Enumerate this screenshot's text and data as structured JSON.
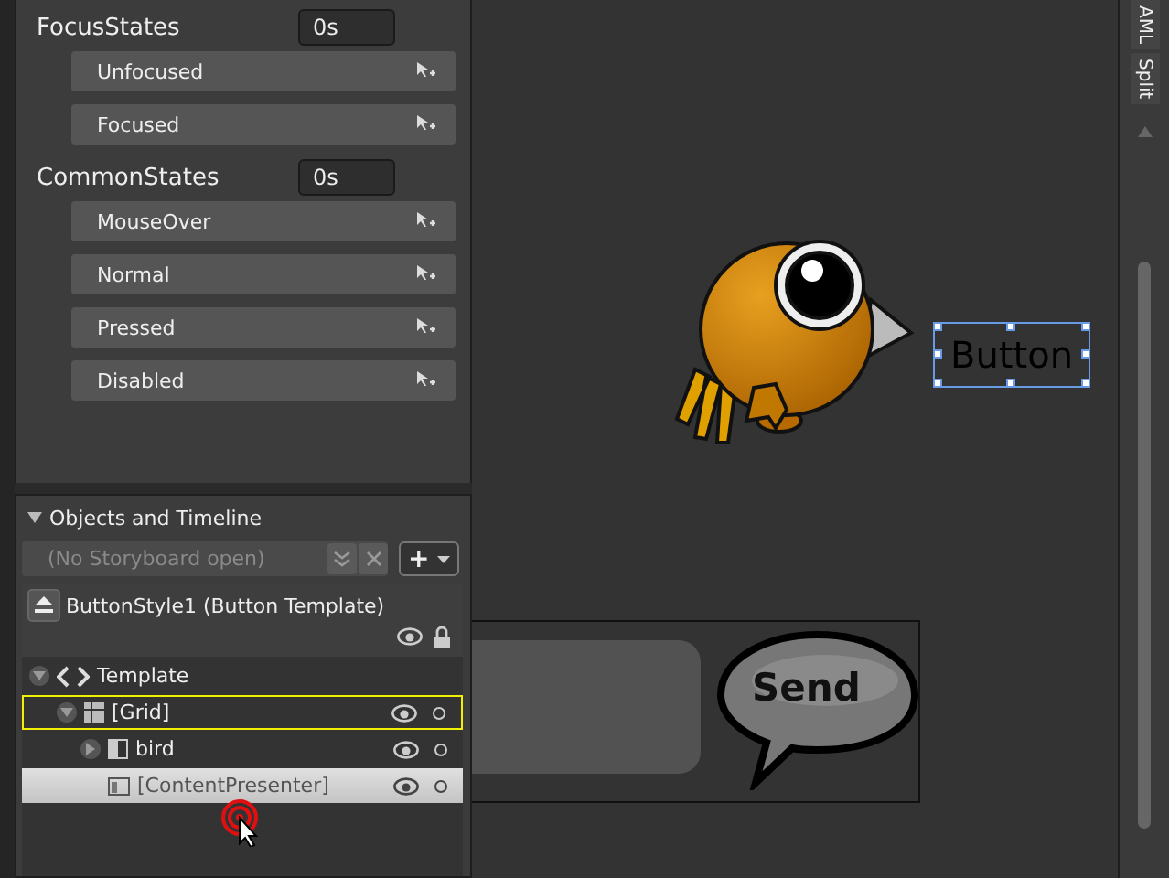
{
  "state_groups": [
    {
      "name": "FocusStates",
      "duration": "0s",
      "states": [
        "Unfocused",
        "Focused"
      ]
    },
    {
      "name": "CommonStates",
      "duration": "0s",
      "states": [
        "MouseOver",
        "Normal",
        "Pressed",
        "Disabled"
      ]
    }
  ],
  "objects_panel": {
    "title": "Objects and Timeline",
    "expanded": true,
    "storyboard": {
      "placeholder": "(No Storyboard open)"
    },
    "add_button": "+",
    "template_header": "ButtonStyle1 (Button Template)",
    "tree": [
      {
        "label": "Template",
        "kind": "template",
        "expanded": true,
        "selected": false,
        "active": false,
        "children": [
          {
            "label": "[Grid]",
            "kind": "grid",
            "expanded": true,
            "selected": false,
            "active": true,
            "children": [
              {
                "label": "bird",
                "kind": "element",
                "expanded": false,
                "selected": false,
                "active": false
              },
              {
                "label": "[ContentPresenter]",
                "kind": "presenter",
                "selected": true,
                "active": false
              }
            ]
          }
        ]
      }
    ]
  },
  "canvas": {
    "button_text": "Button",
    "send_label": "Send"
  },
  "view_tabs": [
    "AML",
    "Split"
  ]
}
